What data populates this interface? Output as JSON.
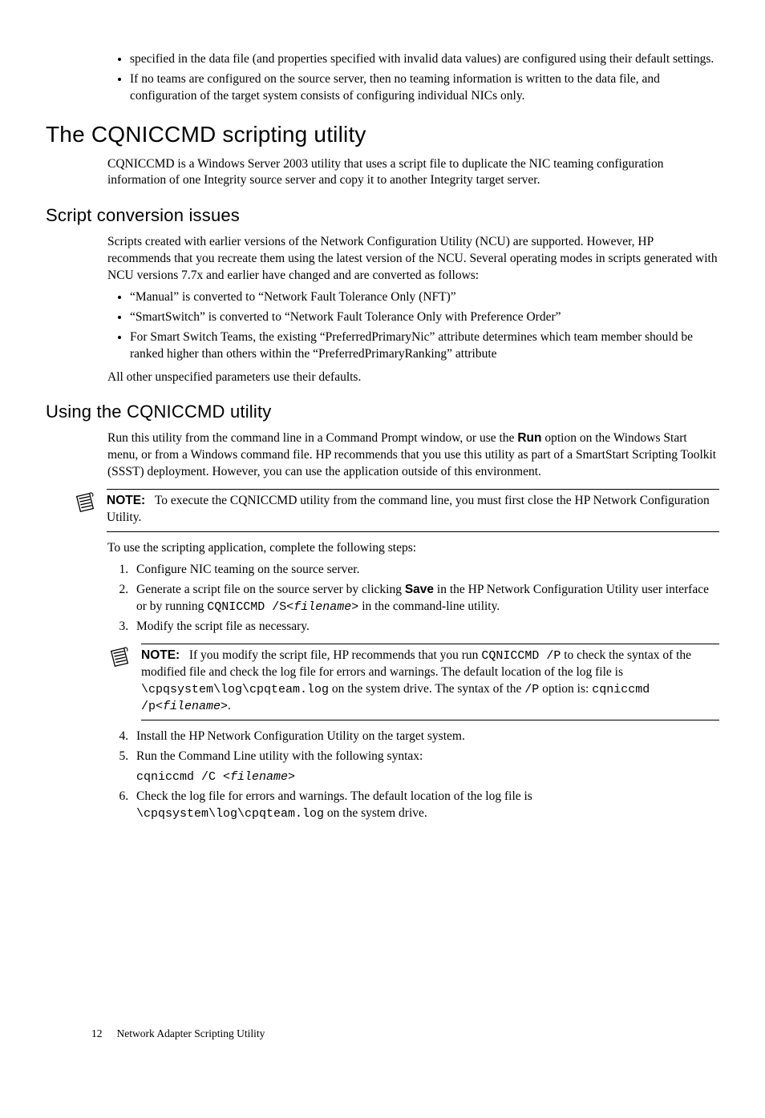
{
  "intro_bullets": {
    "b1": "specified in the data file (and properties specified with invalid data values) are configured using their default settings.",
    "b2": "If no teams are configured on the source server, then no teaming information is written to the data file, and configuration of the target system consists of configuring individual NICs only."
  },
  "h1_cqniccmd": "The CQNICCMD scripting utility",
  "p_cqniccmd_intro": "CQNICCMD is a Windows Server 2003 utility that uses a script file to duplicate the NIC teaming configuration information of one Integrity source server and copy it to another Integrity target server.",
  "h2_script_conv": "Script conversion issues",
  "p_script_conv_intro": "Scripts created with earlier versions of the Network Configuration Utility (NCU) are supported. However, HP recommends that you recreate them using the latest version of the NCU. Several operating modes in scripts generated with NCU versions 7.7x and earlier have changed and are converted as follows:",
  "conv_bullets": {
    "b1": "“Manual” is converted to “Network Fault Tolerance Only (NFT)”",
    "b2": "“SmartSwitch” is converted to “Network Fault Tolerance Only with Preference Order”",
    "b3": "For Smart Switch Teams, the existing “PreferredPrimaryNic” attribute determines which team member should be ranked higher than others within the “PreferredPrimaryRanking” attribute"
  },
  "p_unspecified": "All other unspecified parameters use their defaults.",
  "h2_using": "Using the CQNICCMD utility",
  "p_using_intro_1": "Run this utility from the command line in a Command Prompt window, or use the ",
  "p_using_run": "Run",
  "p_using_intro_2": " option on the Windows Start menu, or from a Windows command file. HP recommends that you use this utility as part of a SmartStart Scripting Toolkit (SSST) deployment. However, you can use the application outside of this environment.",
  "note1_label": "NOTE:",
  "note1_text": "To execute the CQNICCMD utility from the command line, you must first close the HP Network Configuration Utility.",
  "p_steps_intro": "To use the scripting application, complete the following steps:",
  "steps": {
    "s1": "Configure NIC teaming on the source server.",
    "s2_pre": "Generate a script file on the source server by clicking ",
    "s2_save": "Save",
    "s2_mid": " in the HP Network Configuration Utility user interface or by running ",
    "s2_code": "CQNICCMD /S",
    "s2_file": "<filename>",
    "s2_post": " in the command-line utility.",
    "s3": "Modify the script file as necessary.",
    "s4": "Install the HP Network Configuration Utility on the target system.",
    "s5_text": "Run the Command Line utility with the following syntax:",
    "s5_cmd_a": "cqniccmd /C ",
    "s5_cmd_b": "<filename>",
    "s6_pre": "Check the log file for errors and warnings. The default location of the log file is ",
    "s6_path": "\\cpqsystem\\log\\cpqteam.log",
    "s6_post": " on the system drive."
  },
  "note2_label": "NOTE:",
  "note2_pre": "If you modify the script file, HP recommends that you run ",
  "note2_cmd1": "CQNICCMD /P",
  "note2_mid1": " to check the syntax of the modified file and check the log file for errors and warnings. The default location of the log file is ",
  "note2_path": "\\cpqsystem\\log\\cpqteam.log",
  "note2_mid2": " on the system drive. The syntax of the ",
  "note2_p": "/P",
  "note2_mid3": " option is: ",
  "note2_cmd2": "cqniccmd /p",
  "note2_file": "<filename>",
  "note2_end": ".",
  "footer": {
    "page": "12",
    "title": "Network Adapter Scripting Utility"
  }
}
